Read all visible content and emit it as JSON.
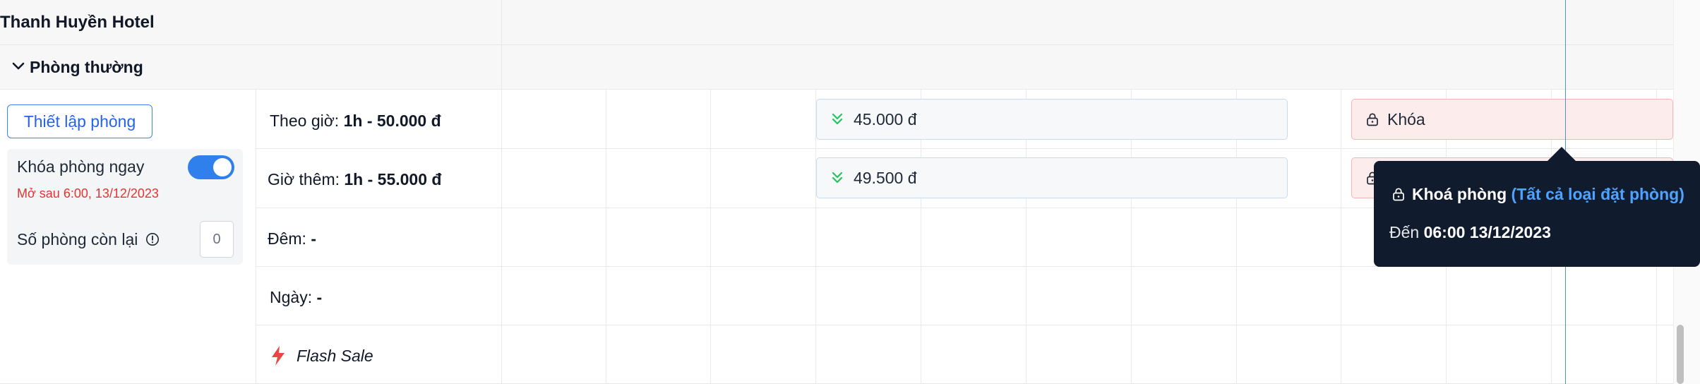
{
  "hotel": {
    "name": "Thanh Huyền Hotel"
  },
  "room_type": {
    "name": "Phòng thường"
  },
  "left_panel": {
    "setup_button": "Thiết lập phòng",
    "lock_now_label": "Khóa phòng ngay",
    "lock_now_enabled": true,
    "open_after": "Mở sau 6:00, 13/12/2023",
    "rooms_left_label": "Số phòng còn lại",
    "rooms_left_value": "0"
  },
  "price_rows": [
    {
      "label": "Theo giờ:",
      "value": "1h - 50.000 đ"
    },
    {
      "label": "Giờ thêm:",
      "value": "1h - 55.000 đ"
    },
    {
      "label": "Đêm:",
      "value": "-"
    },
    {
      "label": "Ngày:",
      "value": "-"
    }
  ],
  "flash_sale": {
    "label": "Flash Sale"
  },
  "calendar_cells": {
    "hourly_price": "45.000 đ",
    "extra_hour_price": "49.500 đ",
    "lock_label": "Khóa"
  },
  "tooltip": {
    "title": "Khoá phòng",
    "subtitle": "(Tất cả loại đặt phòng)",
    "until_label": "Đến",
    "until_value": "06:00 13/12/2023"
  },
  "colors": {
    "accent": "#2f80ed",
    "lock_bg": "#fdecec",
    "danger_text": "#e3342f",
    "tooltip_bg": "#111b2e",
    "tooltip_link": "#4da3ff",
    "price_arrow": "#22c55e",
    "flash_icon": "#ef4444"
  },
  "icons": {
    "chevron": "chevron-down-icon",
    "info": "info-icon",
    "price_down": "double-chevron-down-icon",
    "lock": "lock-icon",
    "flash": "lightning-icon"
  }
}
